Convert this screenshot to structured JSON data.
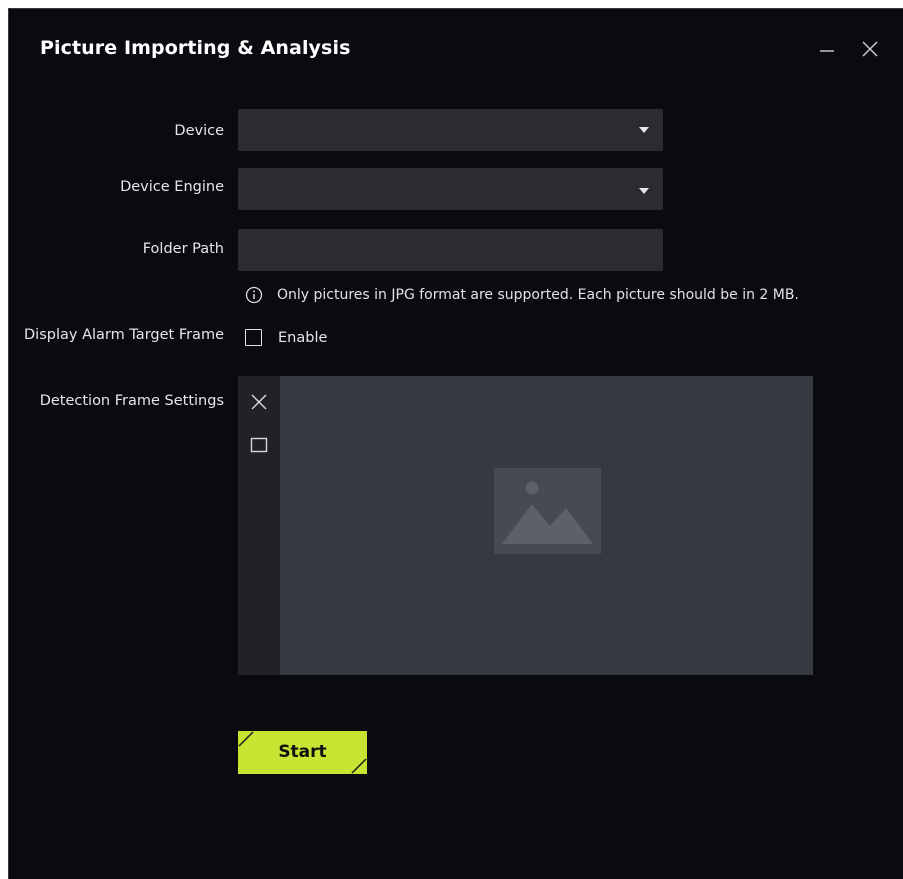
{
  "dialog": {
    "title": "Picture Importing & Analysis"
  },
  "form": {
    "device_label": "Device",
    "device_value": "",
    "device_engine_label": "Device Engine",
    "device_engine_value": "",
    "folder_path_label": "Folder Path",
    "folder_path_value": "",
    "info_text": "Only pictures in JPG format are supported. Each picture should be in 2 MB.",
    "display_alarm_label": "Display Alarm Target Frame",
    "enable_label": "Enable",
    "enable_checked": false,
    "detection_frame_label": "Detection Frame Settings"
  },
  "actions": {
    "start_label": "Start"
  },
  "icons": {
    "minimize": "minimize-icon",
    "close": "close-icon",
    "info": "info-icon",
    "clear_frame": "close-icon",
    "draw_frame": "rectangle-icon",
    "placeholder": "image-placeholder-icon"
  },
  "colors": {
    "background": "#0a0b11",
    "field": "#2a2c31",
    "preview": "#373941",
    "accent": "#c8e332"
  }
}
